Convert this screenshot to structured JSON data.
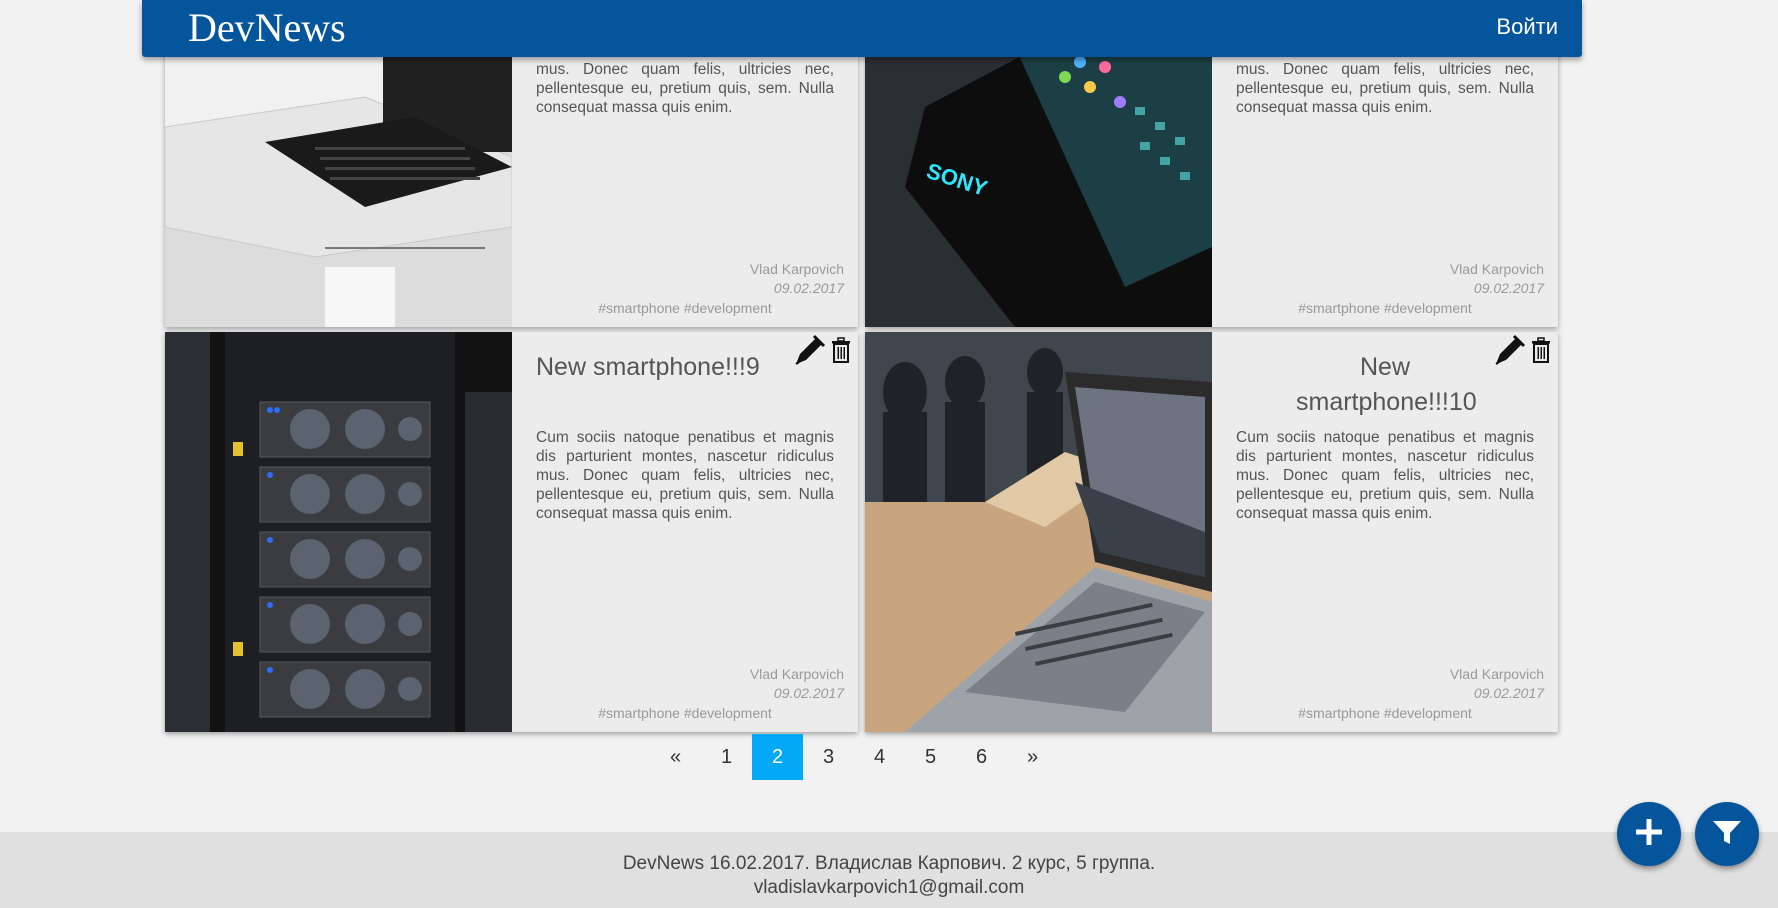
{
  "header": {
    "logo": "DevNews",
    "login_label": "Войти"
  },
  "cards": [
    {
      "title": "",
      "body": "mus. Donec quam felis, ultricies nec, pellentesque eu, pretium quis, sem. Nulla consequat massa quis enim.",
      "author": "Vlad Karpovich",
      "date": "09.02.2017",
      "tags": "#smartphone #development",
      "image": "samsung-laptop-photo"
    },
    {
      "title": "",
      "body": "mus. Donec quam felis, ultricies nec, pellentesque eu, pretium quis, sem. Nulla consequat massa quis enim.",
      "author": "Vlad Karpovich",
      "date": "09.02.2017",
      "tags": "#smartphone #development",
      "image": "sony-phone-photo"
    },
    {
      "title": "New smartphone!!!9",
      "body": "Cum sociis natoque penatibus et magnis dis parturient montes, nascetur ridiculus mus. Donec quam felis, ultricies nec, pellentesque eu, pretium quis, sem. Nulla consequat massa quis enim.",
      "author": "Vlad Karpovich",
      "date": "09.02.2017",
      "tags": "#smartphone #development",
      "image": "server-rack-photo"
    },
    {
      "title": "New smartphone!!!10",
      "body": "Cum sociis natoque penatibus et magnis dis parturient montes, nascetur ridiculus mus. Donec quam felis, ultricies nec, pellentesque eu, pretium quis, sem. Nulla consequat massa quis enim.",
      "author": "Vlad Karpovich",
      "date": "09.02.2017",
      "tags": "#smartphone #development",
      "image": "macbook-photo"
    }
  ],
  "icons": {
    "edit": "pen-icon",
    "delete": "trash-icon",
    "add": "plus-icon",
    "filter": "filter-icon"
  },
  "pagination": {
    "prev": "«",
    "pages": [
      "1",
      "2",
      "3",
      "4",
      "5",
      "6"
    ],
    "active": "2",
    "next": "»"
  },
  "footer": {
    "line1": "DevNews 16.02.2017. Владислав Карпович. 2 курс, 5 группа.",
    "line2": "vladislavkarpovich1@gmail.com"
  },
  "colors": {
    "header_bg": "#05559c",
    "active_page": "#03a9f4",
    "fab_bg": "#05559c",
    "page_bg": "#f2f2f2",
    "footer_bg": "#e0e0e0"
  }
}
